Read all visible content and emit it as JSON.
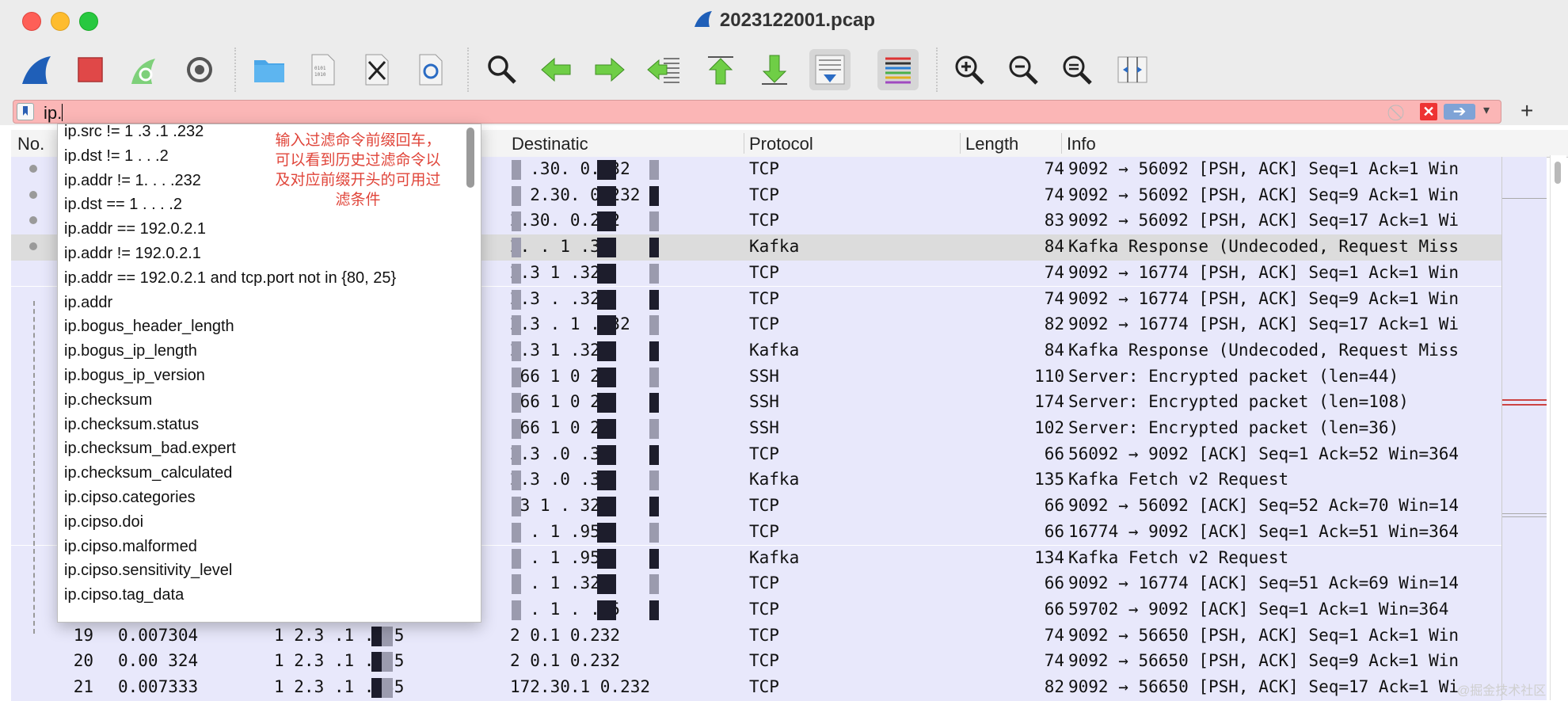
{
  "window": {
    "title": "2023122001.pcap",
    "controls": [
      "close",
      "minimize",
      "zoom"
    ]
  },
  "toolbar": {
    "buttons": [
      {
        "icon": "shark-fin-icon",
        "tip": "Start capture"
      },
      {
        "icon": "stop-icon",
        "tip": "Stop capture"
      },
      {
        "icon": "restart-icon",
        "tip": "Restart capture"
      },
      {
        "icon": "gear-icon",
        "tip": "Capture options"
      },
      {
        "icon": "folder-icon",
        "tip": "Open"
      },
      {
        "icon": "file-binary-icon",
        "tip": "Save"
      },
      {
        "icon": "close-file-icon",
        "tip": "Close"
      },
      {
        "icon": "reload-icon",
        "tip": "Reload"
      },
      {
        "icon": "search-icon",
        "tip": "Find"
      },
      {
        "icon": "arrow-left-icon",
        "tip": "Back"
      },
      {
        "icon": "arrow-right-icon",
        "tip": "Forward"
      },
      {
        "icon": "go-to-packet-icon",
        "tip": "Go to packet"
      },
      {
        "icon": "first-packet-icon",
        "tip": "First packet"
      },
      {
        "icon": "last-packet-icon",
        "tip": "Last packet"
      },
      {
        "icon": "autoscroll-icon",
        "tip": "Auto scroll"
      },
      {
        "icon": "colorize-icon",
        "tip": "Colorize"
      },
      {
        "icon": "zoom-in-icon",
        "tip": "Zoom in"
      },
      {
        "icon": "zoom-out-icon",
        "tip": "Zoom out"
      },
      {
        "icon": "zoom-reset-icon",
        "tip": "Normal size"
      },
      {
        "icon": "resize-columns-icon",
        "tip": "Resize columns"
      }
    ]
  },
  "filter": {
    "value": "ip."
  },
  "columns": [
    "No.",
    "Destinatic",
    "Protocol",
    "Length",
    "Info"
  ],
  "rows": [
    {
      "no": "",
      "time": "",
      "src": "",
      "dst": "1 .30.  0.232",
      "proto": "TCP",
      "len": "74",
      "info": "9092 → 56092 [PSH, ACK] Seq=1 Ack=1 Win"
    },
    {
      "no": "",
      "time": "",
      "src": "",
      "dst": "1 2.30.  0.232",
      "proto": "TCP",
      "len": "74",
      "info": "9092 → 56092 [PSH, ACK] Seq=9 Ack=1 Win"
    },
    {
      "no": "",
      "time": "",
      "src": "",
      "dst": " 2.30.  0.232",
      "proto": "TCP",
      "len": "83",
      "info": "9092 → 56092 [PSH, ACK] Seq=17 Ack=1 Wi"
    },
    {
      "no": "",
      "time": "",
      "src": "",
      "dst": " 2.  .  1 .32",
      "proto": "Kafka",
      "len": "84",
      "info": "Kafka Response (Undecoded, Request Miss"
    },
    {
      "no": "",
      "time": "",
      "src": "",
      "dst": " 2.3   1  .32",
      "proto": "TCP",
      "len": "74",
      "info": "9092 → 16774 [PSH, ACK] Seq=1 Ack=1 Win"
    },
    {
      "no": "",
      "time": "",
      "src": "",
      "dst": " 2.3   .  .32",
      "proto": "TCP",
      "len": "74",
      "info": "9092 → 16774 [PSH, ACK] Seq=9 Ack=1 Win"
    },
    {
      "no": "",
      "time": "",
      "src": "",
      "dst": " 2.3 . 1 . 32",
      "proto": "TCP",
      "len": "82",
      "info": "9092 → 16774 [PSH, ACK] Seq=17 Ack=1 Wi"
    },
    {
      "no": "",
      "time": "",
      "src": "",
      "dst": " 2.3   1  .32",
      "proto": "Kafka",
      "len": "84",
      "info": "Kafka Response (Undecoded, Request Miss"
    },
    {
      "no": "",
      "time": "",
      "src": "",
      "dst": " .66 1 0 2",
      "proto": "SSH",
      "len": "110",
      "info": "Server: Encrypted packet (len=44)"
    },
    {
      "no": "",
      "time": "",
      "src": "",
      "dst": " .66 1 0 2",
      "proto": "SSH",
      "len": "174",
      "info": "Server: Encrypted packet (len=108)"
    },
    {
      "no": "",
      "time": "",
      "src": "",
      "dst": " .66 1 0 2",
      "proto": "SSH",
      "len": "102",
      "info": "Server: Encrypted packet (len=36)"
    },
    {
      "no": "",
      "time": "",
      "src": "",
      "dst": " 2.3  .0  .35",
      "proto": "TCP",
      "len": "66",
      "info": "56092 → 9092 [ACK] Seq=1 Ack=52 Win=364"
    },
    {
      "no": "",
      "time": "",
      "src": "",
      "dst": " 2.3  .0  .35",
      "proto": "Kafka",
      "len": "135",
      "info": "Kafka Fetch v2 Request"
    },
    {
      "no": "",
      "time": "",
      "src": "",
      "dst": " .3   1 .  32",
      "proto": "TCP",
      "len": "66",
      "info": "9092 → 56092 [ACK] Seq=52 Ack=70 Win=14"
    },
    {
      "no": "",
      "time": "",
      "src": "",
      "dst": " .  .  1   .95",
      "proto": "TCP",
      "len": "66",
      "info": "16774 → 9092 [ACK] Seq=1 Ack=51 Win=364"
    },
    {
      "no": "",
      "time": "",
      "src": "",
      "dst": " .  .  1   .95",
      "proto": "Kafka",
      "len": "134",
      "info": "Kafka Fetch v2 Request"
    },
    {
      "no": "",
      "time": "",
      "src": "",
      "dst": " .  . 1  .32",
      "proto": "TCP",
      "len": "66",
      "info": "9092 → 16774 [ACK] Seq=51 Ack=69 Win=14"
    },
    {
      "no": "",
      "time": "",
      "src": "",
      "dst": " .  . 1 .  .35",
      "proto": "TCP",
      "len": "66",
      "info": "59702 → 9092 [ACK] Seq=1 Ack=1 Win=364"
    },
    {
      "no": "19",
      "time": "0.007304",
      "src": "1 2.3  .1  .1 5",
      "dst": " 2  0.1 0.232",
      "proto": "TCP",
      "len": "74",
      "info": "9092 → 56650 [PSH, ACK] Seq=1 Ack=1 Win"
    },
    {
      "no": "20",
      "time": "0.00 324",
      "src": "1 2.3  .1  .1 5",
      "dst": " 2  0.1 0.232",
      "proto": "TCP",
      "len": "74",
      "info": "9092 → 56650 [PSH, ACK] Seq=9 Ack=1 Win"
    },
    {
      "no": "21",
      "time": "0.007333",
      "src": "1 2.3  .1  .135",
      "dst": "172.30.1 0.232",
      "proto": "TCP",
      "len": "82",
      "info": "9092 → 56650 [PSH, ACK] Seq=17 Ack=1 Wi"
    }
  ],
  "selected_row_index": 3,
  "autocomplete": {
    "items": [
      "ip.src != 1 .3 .1 .232",
      "ip.dst != 1  .  .   .2",
      "ip.addr != 1.  .  .   .232",
      "ip.dst == 1 .  .  .  .2",
      "ip.addr == 192.0.2.1",
      "ip.addr != 192.0.2.1",
      "ip.addr == 192.0.2.1 and tcp.port not in {80, 25}",
      "ip.addr",
      "ip.bogus_header_length",
      "ip.bogus_ip_length",
      "ip.bogus_ip_version",
      "ip.checksum",
      "ip.checksum.status",
      "ip.checksum_bad.expert",
      "ip.checksum_calculated",
      "ip.cipso.categories",
      "ip.cipso.doi",
      "ip.cipso.malformed",
      "ip.cipso.sensitivity_level",
      "ip.cipso.tag_data"
    ],
    "annotation": "输入过滤命令前缀回车，可以看到历史过滤命令以及对应前缀开头的可用过滤条件"
  },
  "watermark": "@掘金技术社区",
  "colors": {
    "filter_invalid_bg": "#fbb6b6",
    "row_bg": "#e8e8fb",
    "selected_row_bg": "#dcdcdc",
    "annotation": "#e0453a"
  }
}
